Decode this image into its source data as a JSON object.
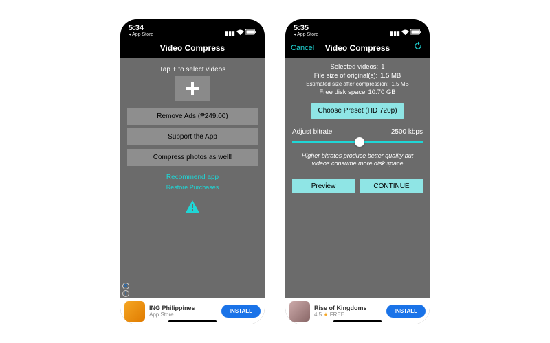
{
  "left": {
    "status": {
      "time": "5:34",
      "back": "◂ App Store"
    },
    "nav": {
      "title": "Video Compress"
    },
    "tap_label": "Tap + to select videos",
    "buttons": {
      "remove_ads": "Remove Ads (₱249.00)",
      "support": "Support the App",
      "compress_photos": "Compress photos as well!"
    },
    "links": {
      "recommend": "Recommend app",
      "restore": "Restore Purchases"
    },
    "ad": {
      "title": "ING Philippines",
      "subtitle": "App Store",
      "cta": "INSTALL"
    }
  },
  "right": {
    "status": {
      "time": "5:35",
      "back": "◂ App Store"
    },
    "nav": {
      "title": "Video Compress",
      "cancel": "Cancel"
    },
    "info": {
      "selected_label": "Selected videos:",
      "selected_value": "1",
      "filesize_label": "File size of original(s):",
      "filesize_value": "1.5 MB",
      "est_label": "Estimated size after compression:",
      "est_value": "1.5 MB",
      "free_label": "Free disk space",
      "free_value": "10.70 GB"
    },
    "preset_btn": "Choose Preset (HD 720p)",
    "slider_label": "Adjust bitrate",
    "slider_value": "2500 kbps",
    "hint": "Higher bitrates produce better quality but videos consume more disk space",
    "actions": {
      "preview": "Preview",
      "continue": "CONTINUE"
    },
    "ad": {
      "title": "Rise of Kingdoms",
      "rating": "4.5",
      "price": "FREE",
      "cta": "INSTALL"
    }
  }
}
